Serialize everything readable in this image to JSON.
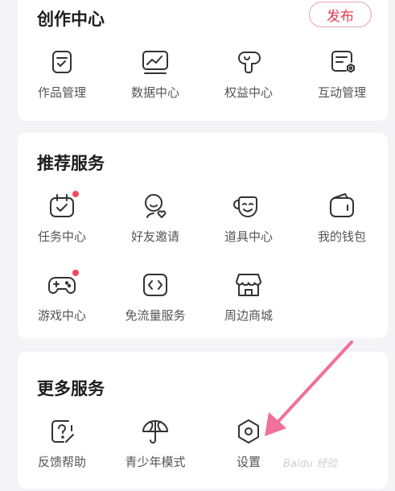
{
  "creation": {
    "title": "创作中心",
    "publish_label": "发布",
    "items": [
      {
        "label": "作品管理",
        "icon": "works-manage-icon"
      },
      {
        "label": "数据中心",
        "icon": "data-chart-icon"
      },
      {
        "label": "权益中心",
        "icon": "benefits-icon"
      },
      {
        "label": "互动管理",
        "icon": "interaction-manage-icon"
      }
    ]
  },
  "recommended": {
    "title": "推荐服务",
    "items": [
      {
        "label": "任务中心",
        "icon": "task-calendar-icon",
        "badge": true
      },
      {
        "label": "好友邀请",
        "icon": "invite-friend-icon"
      },
      {
        "label": "道具中心",
        "icon": "props-mask-icon"
      },
      {
        "label": "我的钱包",
        "icon": "wallet-icon"
      },
      {
        "label": "游戏中心",
        "icon": "gamepad-icon",
        "badge": true
      },
      {
        "label": "免流量服务",
        "icon": "free-data-icon"
      },
      {
        "label": "周边商城",
        "icon": "store-icon"
      }
    ]
  },
  "more": {
    "title": "更多服务",
    "items": [
      {
        "label": "反馈帮助",
        "icon": "feedback-help-icon"
      },
      {
        "label": "青少年模式",
        "icon": "umbrella-icon"
      },
      {
        "label": "设置",
        "icon": "settings-hexagon-icon"
      }
    ]
  },
  "annotation": {
    "arrow_color": "#f0709a",
    "points_to": "设置"
  },
  "watermark": "Baidu 经验",
  "colors": {
    "accent": "#e43b55",
    "badge": "#ee4a5f",
    "icon": "#333333",
    "background": "#f4f4f6"
  }
}
